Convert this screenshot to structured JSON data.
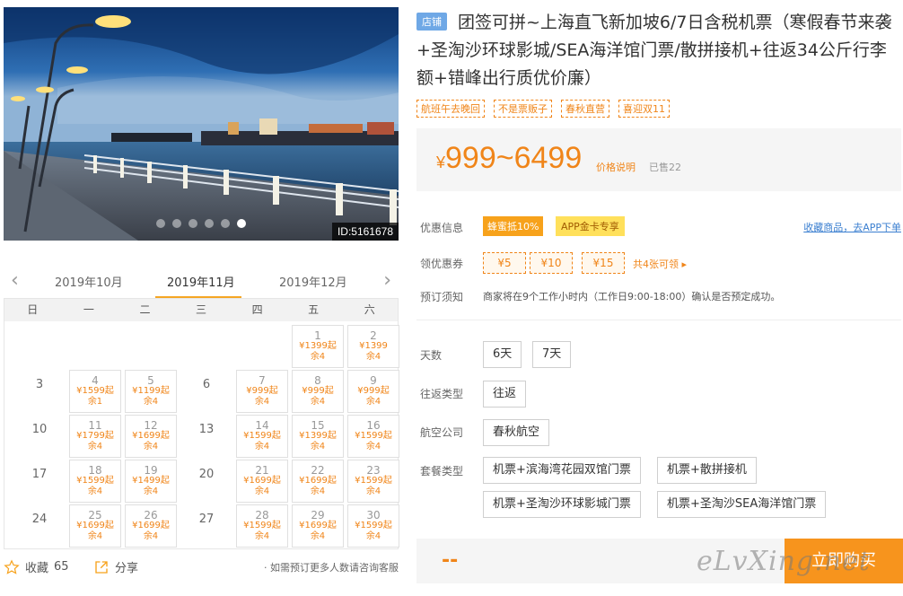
{
  "gallery": {
    "photo_id": "ID:5161678",
    "dots": 6,
    "active_dot": 5
  },
  "calendar": {
    "prev_month": "2019年10月",
    "current_month": "2019年11月",
    "next_month": "2019年12月",
    "weekdays": [
      "日",
      "一",
      "二",
      "三",
      "四",
      "五",
      "六"
    ],
    "days": [
      {
        "d": "1",
        "price": "¥1399起",
        "rem": "余4"
      },
      {
        "d": "2",
        "price": "¥1399",
        "rem": "余4"
      },
      {
        "d": "3"
      },
      {
        "d": "4",
        "price": "¥1599起",
        "rem": "余1"
      },
      {
        "d": "5",
        "price": "¥1199起",
        "rem": "余4"
      },
      {
        "d": "6"
      },
      {
        "d": "7",
        "price": "¥999起",
        "rem": "余4"
      },
      {
        "d": "8",
        "price": "¥999起",
        "rem": "余4"
      },
      {
        "d": "9",
        "price": "¥999起",
        "rem": "余4"
      },
      {
        "d": "10"
      },
      {
        "d": "11",
        "price": "¥1799起",
        "rem": "余4"
      },
      {
        "d": "12",
        "price": "¥1699起",
        "rem": "余4"
      },
      {
        "d": "13"
      },
      {
        "d": "14",
        "price": "¥1599起",
        "rem": "余4"
      },
      {
        "d": "15",
        "price": "¥1399起",
        "rem": "余4"
      },
      {
        "d": "16",
        "price": "¥1599起",
        "rem": "余4"
      },
      {
        "d": "17"
      },
      {
        "d": "18",
        "price": "¥1599起",
        "rem": "余4"
      },
      {
        "d": "19",
        "price": "¥1499起",
        "rem": "余4"
      },
      {
        "d": "20"
      },
      {
        "d": "21",
        "price": "¥1699起",
        "rem": "余4"
      },
      {
        "d": "22",
        "price": "¥1699起",
        "rem": "余4"
      },
      {
        "d": "23",
        "price": "¥1599起",
        "rem": "余4"
      },
      {
        "d": "24"
      },
      {
        "d": "25",
        "price": "¥1699起",
        "rem": "余4"
      },
      {
        "d": "26",
        "price": "¥1699起",
        "rem": "余4"
      },
      {
        "d": "27"
      },
      {
        "d": "28",
        "price": "¥1599起",
        "rem": "余4"
      },
      {
        "d": "29",
        "price": "¥1699起",
        "rem": "余4"
      },
      {
        "d": "30",
        "price": "¥1599起",
        "rem": "余4"
      }
    ]
  },
  "footer_left": {
    "favorite_label": "收藏",
    "favorite_count": "65",
    "share_label": "分享",
    "consult": "· 如需预订更多人数请咨询客服"
  },
  "product": {
    "store_badge": "店铺",
    "title": "团签可拼~上海直飞新加坡6/7日含税机票（寒假春节来袭+圣淘沙环球影城/SEA海洋馆门票/散拼接机+往返34公斤行李额+错峰出行质优价廉）",
    "tags": [
      "航班午去晚回",
      "不是票贩子",
      "春秋直营",
      "喜迎双11"
    ],
    "price_yen": "¥",
    "price_range": "999~6499",
    "price_note": "价格说明",
    "sold": "已售22"
  },
  "promo": {
    "label": "优惠信息",
    "fengmi": "蜂蜜抵10%",
    "app_card": "APP金卡专享",
    "fav_link": "收藏商品，去APP下单"
  },
  "coupons": {
    "label": "领优惠券",
    "items": [
      "¥5",
      "¥10",
      "¥15"
    ],
    "more": "共4张可领 ▸"
  },
  "notice": {
    "label": "预订须知",
    "text": "商家将在9个工作小时内（工作日9:00-18:00）确认是否预定成功。"
  },
  "options": {
    "days_label": "天数",
    "days": [
      "6天",
      "7天"
    ],
    "trip_label": "往返类型",
    "trip": [
      "往返"
    ],
    "airline_label": "航空公司",
    "airline": [
      "春秋航空"
    ],
    "package_label": "套餐类型",
    "packages": [
      "机票+滨海湾花园双馆门票",
      "机票+散拼接机",
      "机票+圣淘沙环球影城门票",
      "机票+圣淘沙SEA海洋馆门票"
    ]
  },
  "buy": {
    "dash": "--",
    "button": "立即购买"
  },
  "watermark": "eLvXing.net"
}
